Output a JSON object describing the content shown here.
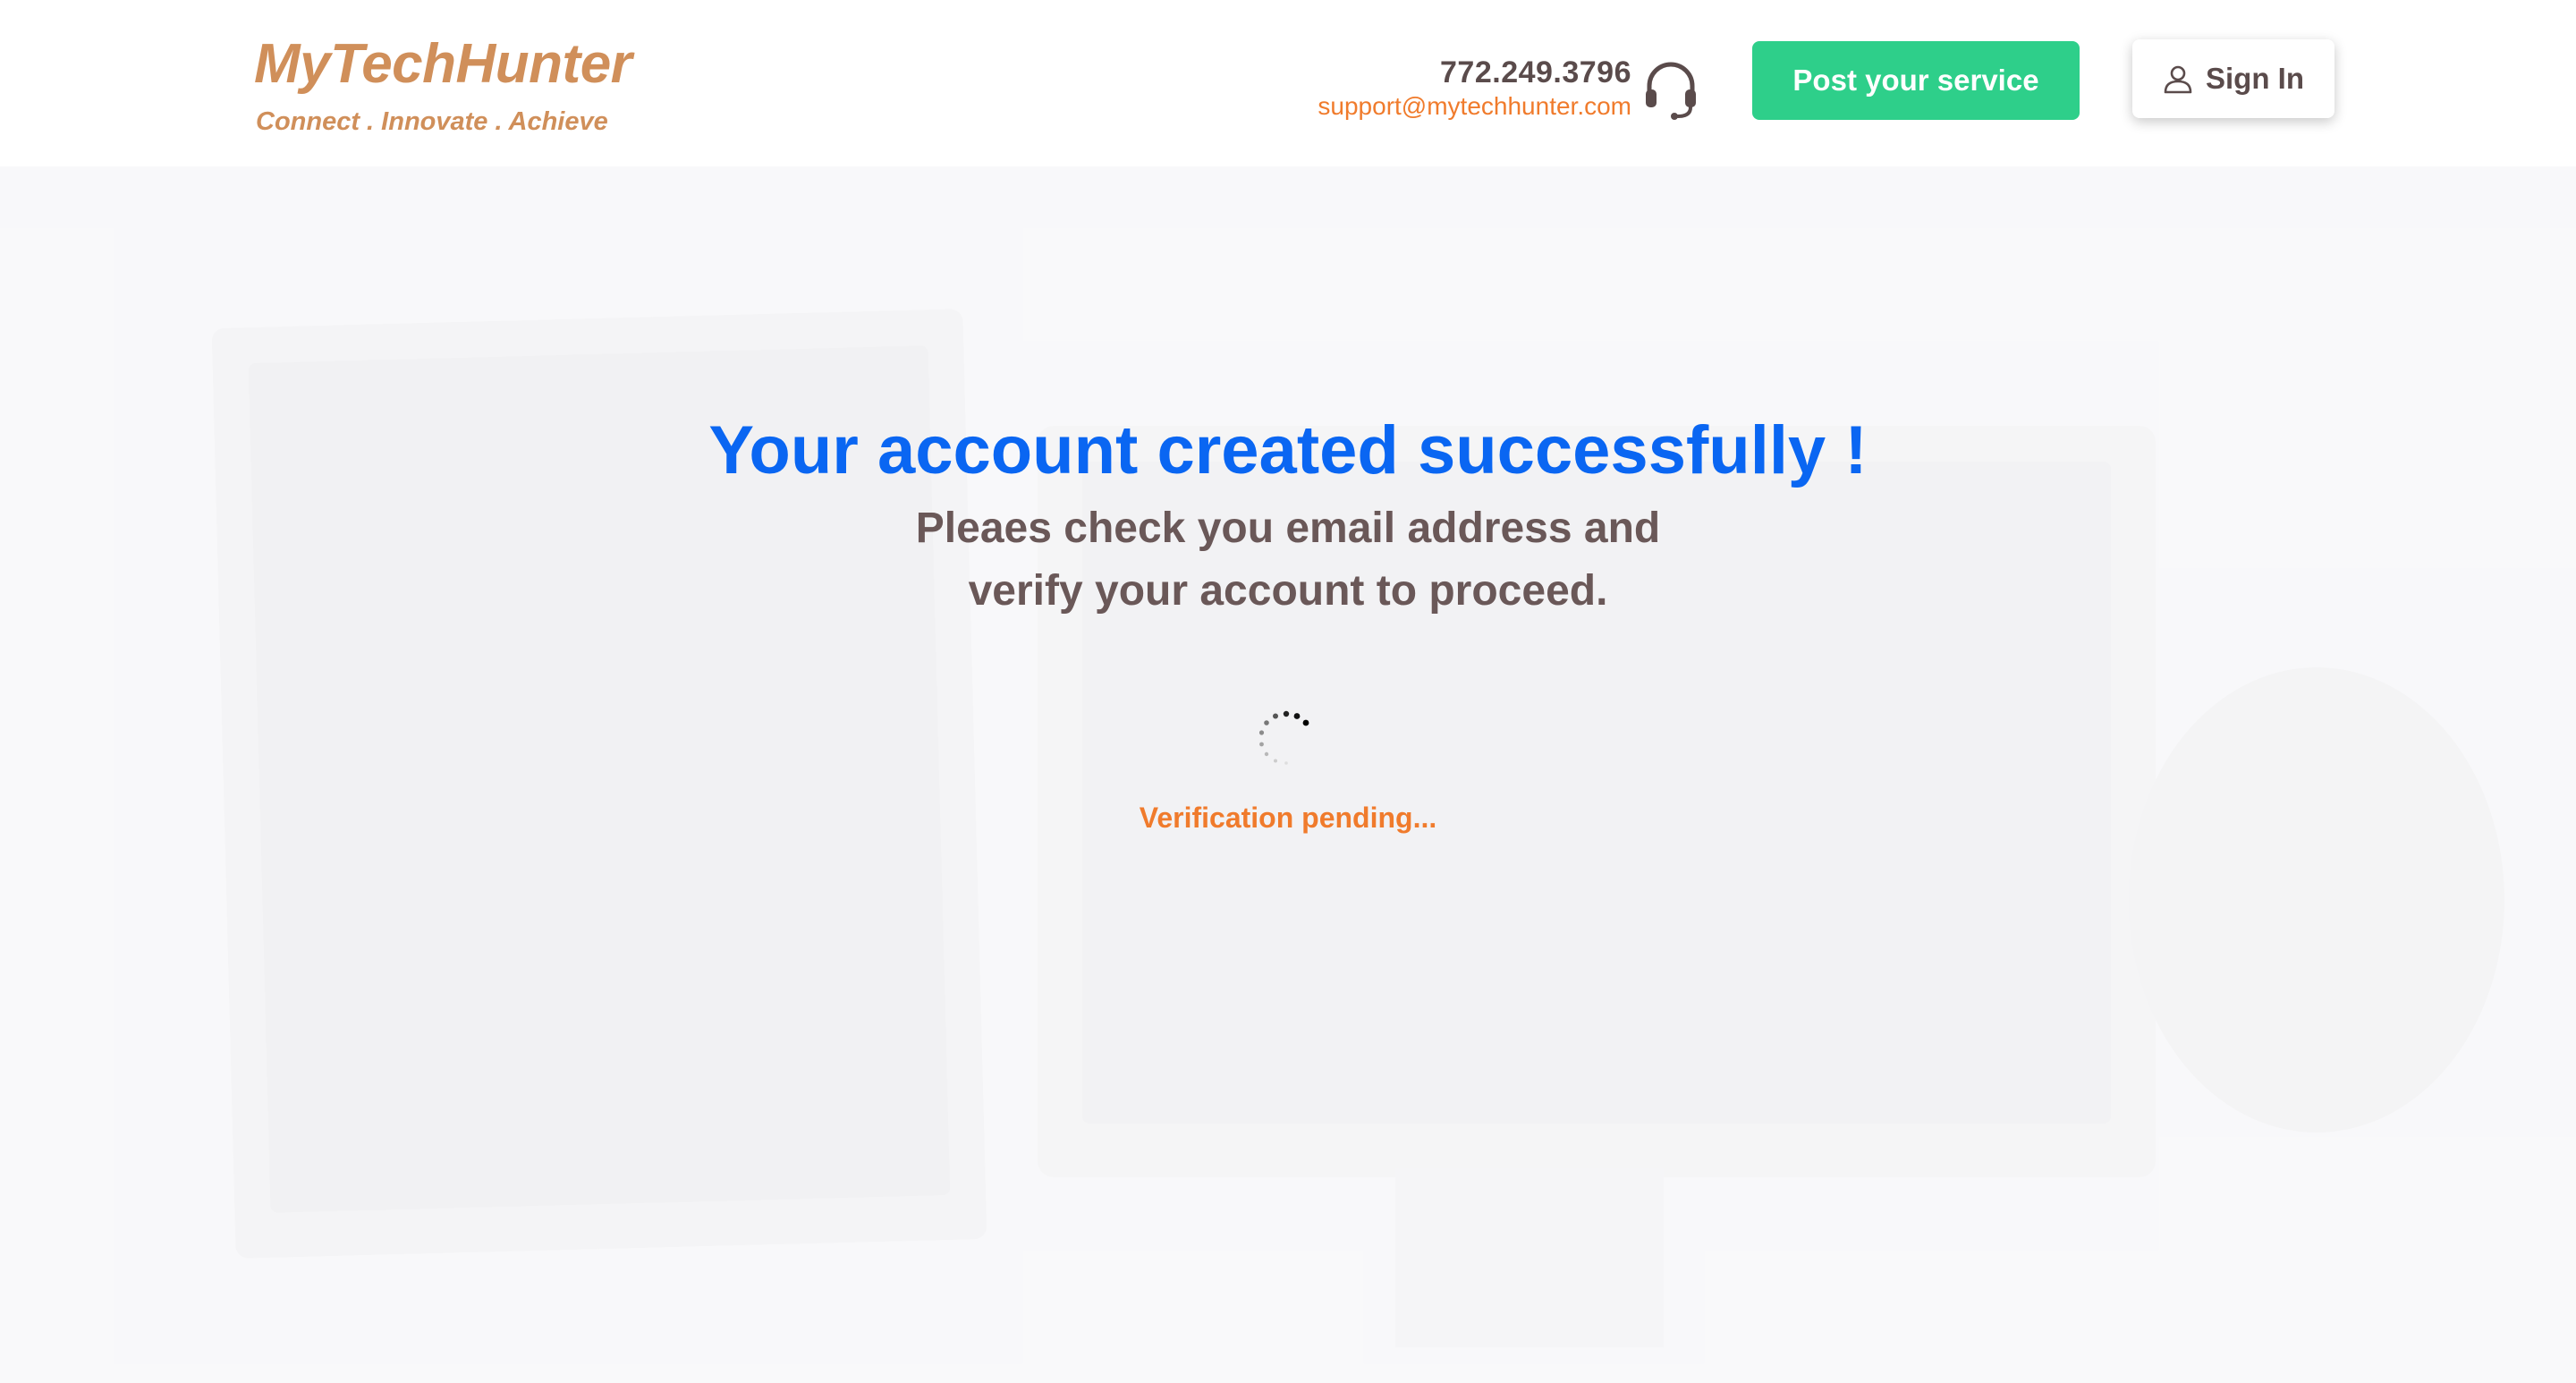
{
  "brand": {
    "name": "MyTechHunter",
    "tagline": "Connect . Innovate . Achieve"
  },
  "contact": {
    "phone": "772.249.3796",
    "email": "support@mytechhunter.com",
    "icon": "headset-icon"
  },
  "nav": {
    "post_service_label": "Post your service",
    "sign_in_label": "Sign In",
    "sign_in_icon": "user-icon"
  },
  "main": {
    "title": "Your account created successfully !",
    "subtitle_line1": "Pleaes check you email address and",
    "subtitle_line2": "verify your account to proceed.",
    "status": "Verification pending..."
  },
  "colors": {
    "brand": "#d08f5a",
    "accent_green": "#2ecf8a",
    "title_blue": "#0a66f2",
    "status_orange": "#f07b2c"
  }
}
